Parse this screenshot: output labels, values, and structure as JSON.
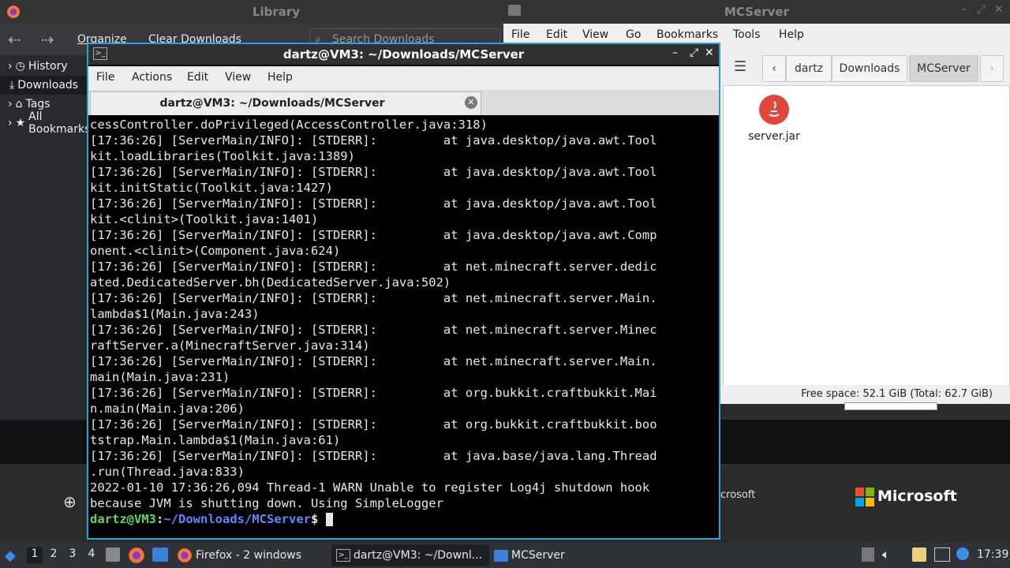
{
  "library": {
    "title": "Library",
    "toolbar": {
      "organize": "Organize",
      "clear": "Clear Downloads",
      "search_placeholder": "Search Downloads"
    },
    "sidebar": [
      {
        "label": "History"
      },
      {
        "label": "Downloads"
      },
      {
        "label": "Tags"
      },
      {
        "label": "All Bookmarks"
      }
    ]
  },
  "file_manager": {
    "title": "MCServer",
    "menu": [
      "File",
      "Edit",
      "View",
      "Go",
      "Bookmarks",
      "Tools",
      "Help"
    ],
    "path": [
      "dartz",
      "Downloads",
      "MCServer"
    ],
    "file": {
      "name": "server.jar"
    },
    "status": "Free space: 52.1 GiB (Total: 62.7 GiB)"
  },
  "terminal": {
    "title": "dartz@VM3: ~/Downloads/MCServer",
    "menu": [
      "File",
      "Actions",
      "Edit",
      "View",
      "Help"
    ],
    "tab_title": "dartz@VM3: ~/Downloads/MCServer",
    "lines": [
      "cessController.doPrivileged(AccessController.java:318)",
      "[17:36:26] [ServerMain/INFO]: [STDERR]:         at java.desktop/java.awt.Tool",
      "kit.loadLibraries(Toolkit.java:1389)",
      "[17:36:26] [ServerMain/INFO]: [STDERR]:         at java.desktop/java.awt.Tool",
      "kit.initStatic(Toolkit.java:1427)",
      "[17:36:26] [ServerMain/INFO]: [STDERR]:         at java.desktop/java.awt.Tool",
      "kit.<clinit>(Toolkit.java:1401)",
      "[17:36:26] [ServerMain/INFO]: [STDERR]:         at java.desktop/java.awt.Comp",
      "onent.<clinit>(Component.java:624)",
      "[17:36:26] [ServerMain/INFO]: [STDERR]:         at net.minecraft.server.dedic",
      "ated.DedicatedServer.bh(DedicatedServer.java:502)",
      "[17:36:26] [ServerMain/INFO]: [STDERR]:         at net.minecraft.server.Main.",
      "lambda$1(Main.java:243)",
      "[17:36:26] [ServerMain/INFO]: [STDERR]:         at net.minecraft.server.Minec",
      "raftServer.a(MinecraftServer.java:314)",
      "[17:36:26] [ServerMain/INFO]: [STDERR]:         at net.minecraft.server.Main.",
      "main(Main.java:231)",
      "[17:36:26] [ServerMain/INFO]: [STDERR]:         at org.bukkit.craftbukkit.Mai",
      "n.main(Main.java:206)",
      "[17:36:26] [ServerMain/INFO]: [STDERR]:         at org.bukkit.craftbukkit.boo",
      "tstrap.Main.lambda$1(Main.java:61)",
      "[17:36:26] [ServerMain/INFO]: [STDERR]:         at java.base/java.lang.Thread",
      ".run(Thread.java:833)",
      "2022-01-10 17:36:26,094 Thread-1 WARN Unable to register Log4j shutdown hook",
      "because JVM is shutting down. Using SimpleLogger"
    ],
    "prompt_user": "dartz@VM3",
    "prompt_sep": ":",
    "prompt_path": "~/Downloads/MCServer",
    "prompt_symbol": "$"
  },
  "desktop": {
    "partial_text": "crosoft",
    "microsoft_label": "Microsoft"
  },
  "taskbar": {
    "workspaces": [
      "1",
      "2",
      "3",
      "4"
    ],
    "tasks": [
      {
        "label": "Firefox - 2 windows"
      },
      {
        "label": "dartz@VM3: ~/Downl..."
      },
      {
        "label": "MCServer"
      }
    ],
    "clock": "17:39"
  },
  "colors": {
    "accent": "#2aa0e0",
    "prompt_user": "#5fd75f",
    "prompt_path": "#5f87ff"
  }
}
